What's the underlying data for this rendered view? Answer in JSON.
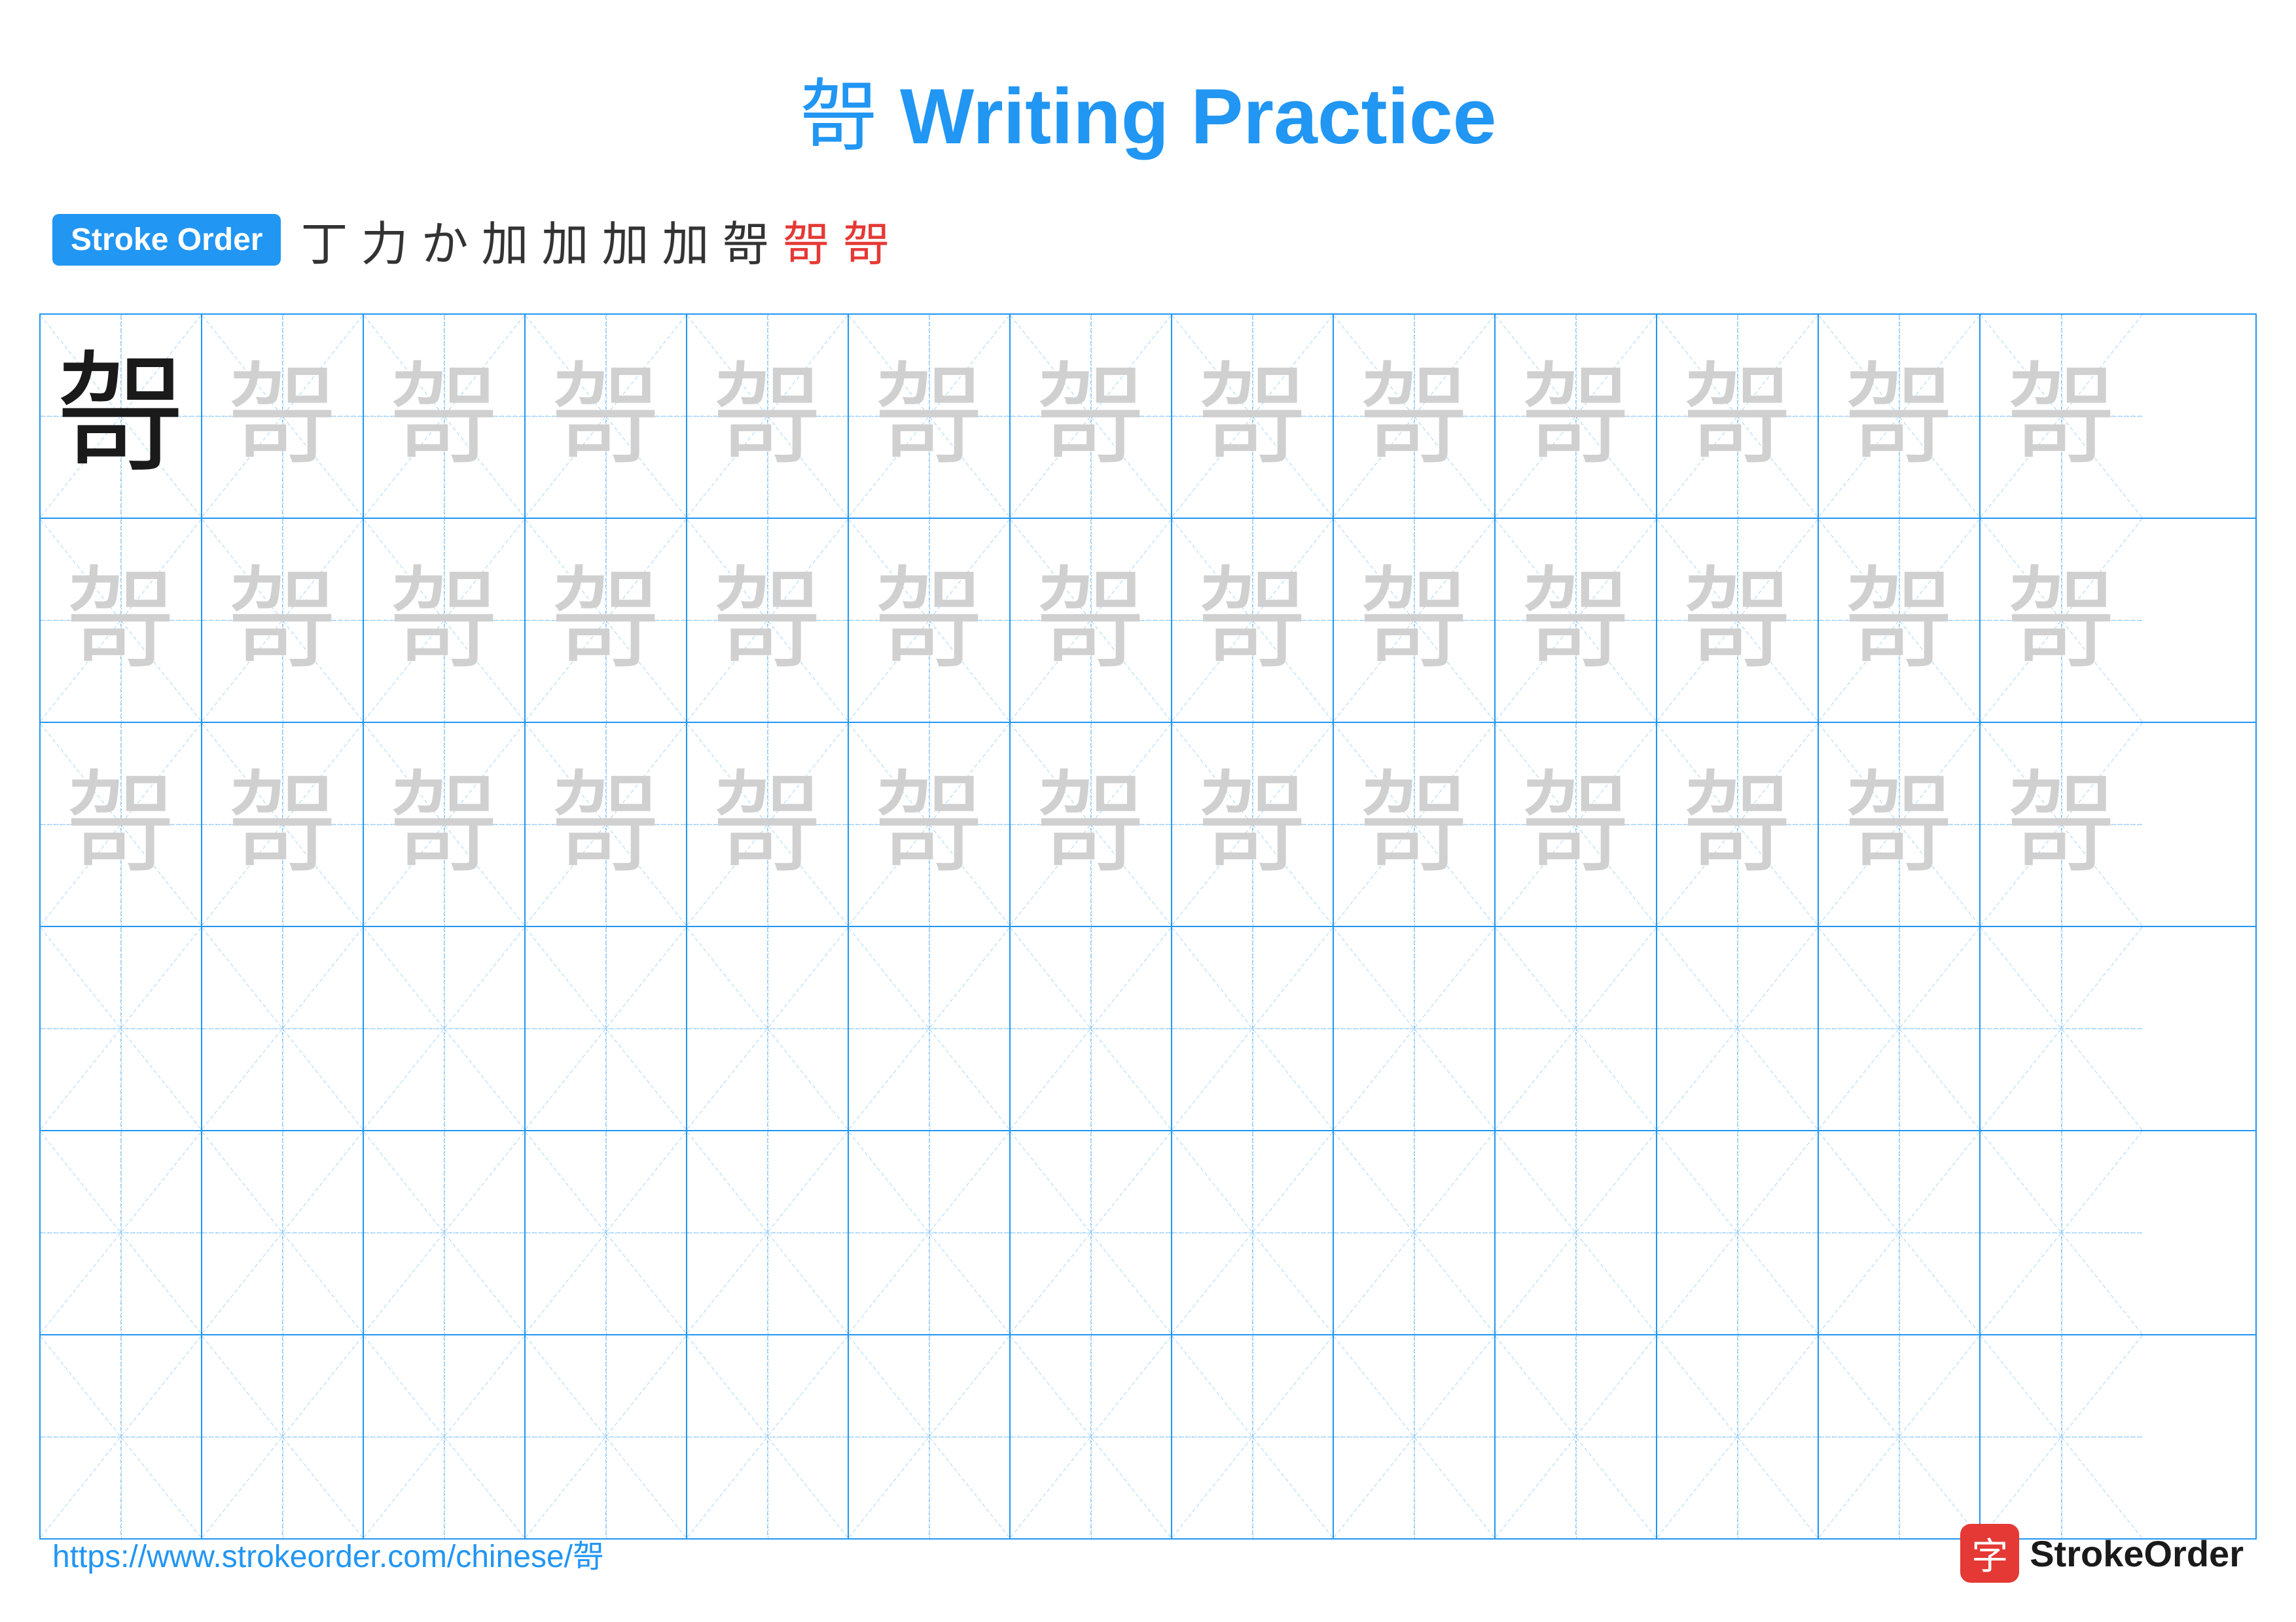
{
  "title": {
    "char": "哿",
    "text": " Writing Practice"
  },
  "stroke_order": {
    "badge_label": "Stroke Order",
    "strokes": [
      "丁",
      "力",
      "か",
      "加",
      "加",
      "加",
      "加",
      "哿",
      "哿",
      "哿"
    ]
  },
  "grid": {
    "rows": 6,
    "cols": 13,
    "char": "哿",
    "filled_rows": [
      {
        "type": "dark_first_light_rest",
        "chars": [
          "哿",
          "哿",
          "哿",
          "哿",
          "哿",
          "哿",
          "哿",
          "哿",
          "哿",
          "哿",
          "哿",
          "哿",
          "哿"
        ]
      },
      {
        "type": "light_all",
        "chars": [
          "哿",
          "哿",
          "哿",
          "哿",
          "哿",
          "哿",
          "哿",
          "哿",
          "哿",
          "哿",
          "哿",
          "哿",
          "哿"
        ]
      },
      {
        "type": "light_all",
        "chars": [
          "哿",
          "哿",
          "哿",
          "哿",
          "哿",
          "哿",
          "哿",
          "哿",
          "哿",
          "哿",
          "哿",
          "哿",
          "哿"
        ]
      },
      {
        "type": "empty",
        "chars": [
          "",
          "",
          "",
          "",
          "",
          "",
          "",
          "",
          "",
          "",
          "",
          "",
          ""
        ]
      },
      {
        "type": "empty",
        "chars": [
          "",
          "",
          "",
          "",
          "",
          "",
          "",
          "",
          "",
          "",
          "",
          "",
          ""
        ]
      },
      {
        "type": "empty",
        "chars": [
          "",
          "",
          "",
          "",
          "",
          "",
          "",
          "",
          "",
          "",
          "",
          "",
          ""
        ]
      }
    ]
  },
  "footer": {
    "url": "https://www.strokeorder.com/chinese/哿",
    "logo_char": "字",
    "logo_text": "StrokeOrder"
  }
}
